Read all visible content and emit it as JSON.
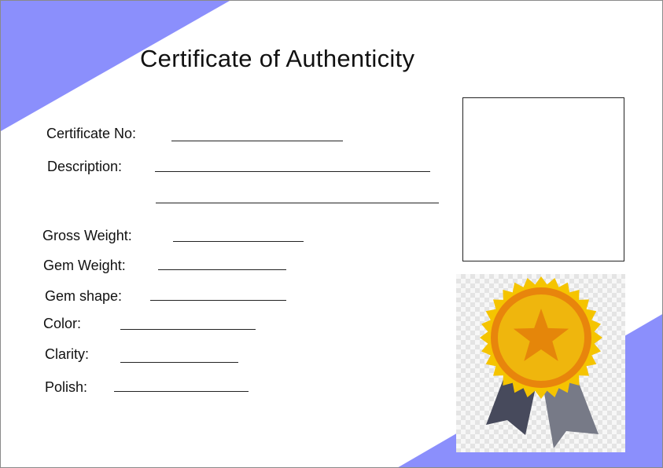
{
  "certificate": {
    "title": "Certificate of Authenticity",
    "accent_color": "#8b8ffc",
    "fields": [
      {
        "id": "certificate-no",
        "label": "Certificate No:"
      },
      {
        "id": "description",
        "label": "Description:"
      },
      {
        "id": "gross-weight",
        "label": "Gross Weight:"
      },
      {
        "id": "gem-weight",
        "label": "Gem Weight:"
      },
      {
        "id": "gem-shape",
        "label": "Gem shape:"
      },
      {
        "id": "color",
        "label": "Color:"
      },
      {
        "id": "clarity",
        "label": "Clarity:"
      },
      {
        "id": "polish",
        "label": "Polish:"
      }
    ],
    "photo_box": "empty-photo-frame",
    "badge_icon": "award-ribbon-star-icon",
    "badge_colors": {
      "outer": "#f5c400",
      "ring": "#e8850c",
      "inner": "#efb60d",
      "star": "#e5860a",
      "ribbon_dark": "#474a5c",
      "ribbon_light": "#777a87"
    }
  }
}
